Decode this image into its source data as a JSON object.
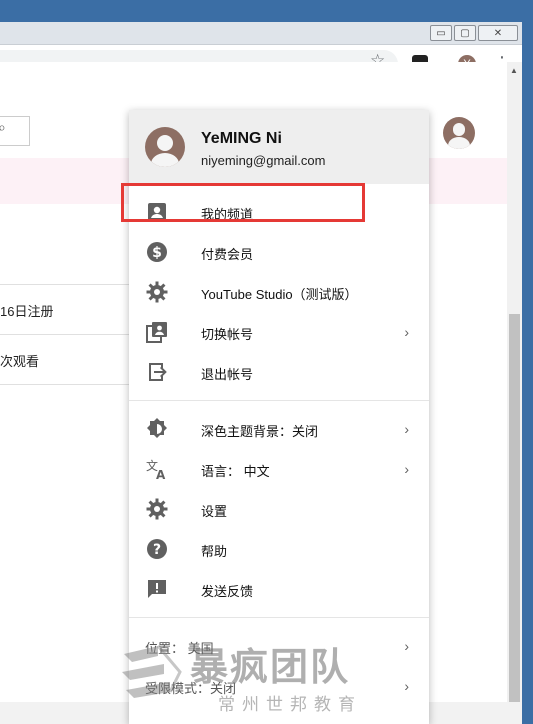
{
  "browser": {
    "window_controls": {
      "minimize": "▭",
      "restore": "▢",
      "close": "✕"
    },
    "toolbar": {
      "star_icon": "☆",
      "profile_initial": "Y",
      "menu_icon": "⋮"
    }
  },
  "page": {
    "search_icon": "⌕",
    "rows": [
      "16日注册",
      "次观看"
    ]
  },
  "account_menu": {
    "user_name": "YeMING Ni",
    "user_email": "niyeming@gmail.com",
    "items": [
      {
        "label": "我的频道",
        "icon": "account-box-icon",
        "arrow": ""
      },
      {
        "label": "付费会员",
        "icon": "dollar-circle-icon",
        "arrow": ""
      },
      {
        "label": "YouTube Studio（测试版）",
        "icon": "gear-icon",
        "arrow": ""
      },
      {
        "label": "切换帐号",
        "icon": "switch-account-icon",
        "arrow": "›"
      },
      {
        "label": "退出帐号",
        "icon": "sign-out-icon",
        "arrow": ""
      }
    ],
    "settings_items": [
      {
        "label": "深色主题背景：关闭",
        "icon": "dark-theme-icon",
        "arrow": "›"
      },
      {
        "label": "语言： 中文",
        "icon": "translate-icon",
        "arrow": "›"
      },
      {
        "label": "设置",
        "icon": "settings-gear-icon",
        "arrow": ""
      },
      {
        "label": "帮助",
        "icon": "help-icon",
        "arrow": ""
      },
      {
        "label": "发送反馈",
        "icon": "feedback-icon",
        "arrow": ""
      }
    ],
    "footer_items": [
      {
        "label": "位置： 美国",
        "arrow": "›"
      },
      {
        "label": "受限模式：关闭",
        "arrow": "›"
      }
    ]
  },
  "annotation": {
    "highlight_color": "#e53935"
  },
  "watermark": {
    "main": "暴疯团队",
    "sub": "常州世邦教育"
  }
}
